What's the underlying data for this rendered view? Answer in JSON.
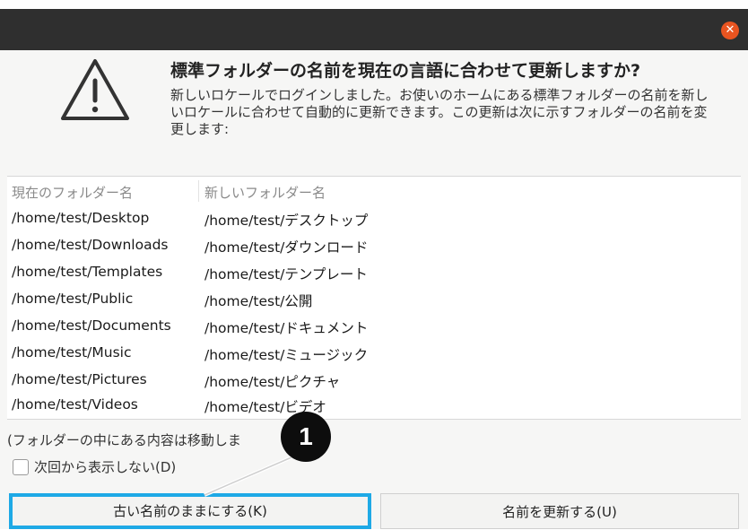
{
  "window": {
    "close_icon": "close-icon"
  },
  "dialog": {
    "icon": "warning-icon",
    "headline": "標準フォルダーの名前を現在の言語に合わせて更新しますか?",
    "description": "新しいロケールでログインしました。お使いのホームにある標準フォルダーの名前を新しいロケールに合わせて自動的に更新できます。この更新は次に示すフォルダーの名前を変更します:",
    "columns": {
      "current": "現在のフォルダー名",
      "new": "新しいフォルダー名"
    },
    "rows": [
      {
        "current": "/home/test/Desktop",
        "new": "/home/test/デスクトップ"
      },
      {
        "current": "/home/test/Downloads",
        "new": "/home/test/ダウンロード"
      },
      {
        "current": "/home/test/Templates",
        "new": "/home/test/テンプレート"
      },
      {
        "current": "/home/test/Public",
        "new": "/home/test/公開"
      },
      {
        "current": "/home/test/Documents",
        "new": "/home/test/ドキュメント"
      },
      {
        "current": "/home/test/Music",
        "new": "/home/test/ミュージック"
      },
      {
        "current": "/home/test/Pictures",
        "new": "/home/test/ピクチャ"
      },
      {
        "current": "/home/test/Videos",
        "new": "/home/test/ビデオ"
      }
    ],
    "note": "(フォルダーの中にある内容は移動しま",
    "checkbox_label": "次回から表示しない(D)",
    "keep_button": "古い名前のままにする(K)",
    "update_button": "名前を更新する(U)"
  },
  "annotation": {
    "callout_number": "1"
  },
  "colors": {
    "titlebar": "#2f2f2f",
    "close": "#e95420",
    "highlight": "#1ea9e6"
  }
}
